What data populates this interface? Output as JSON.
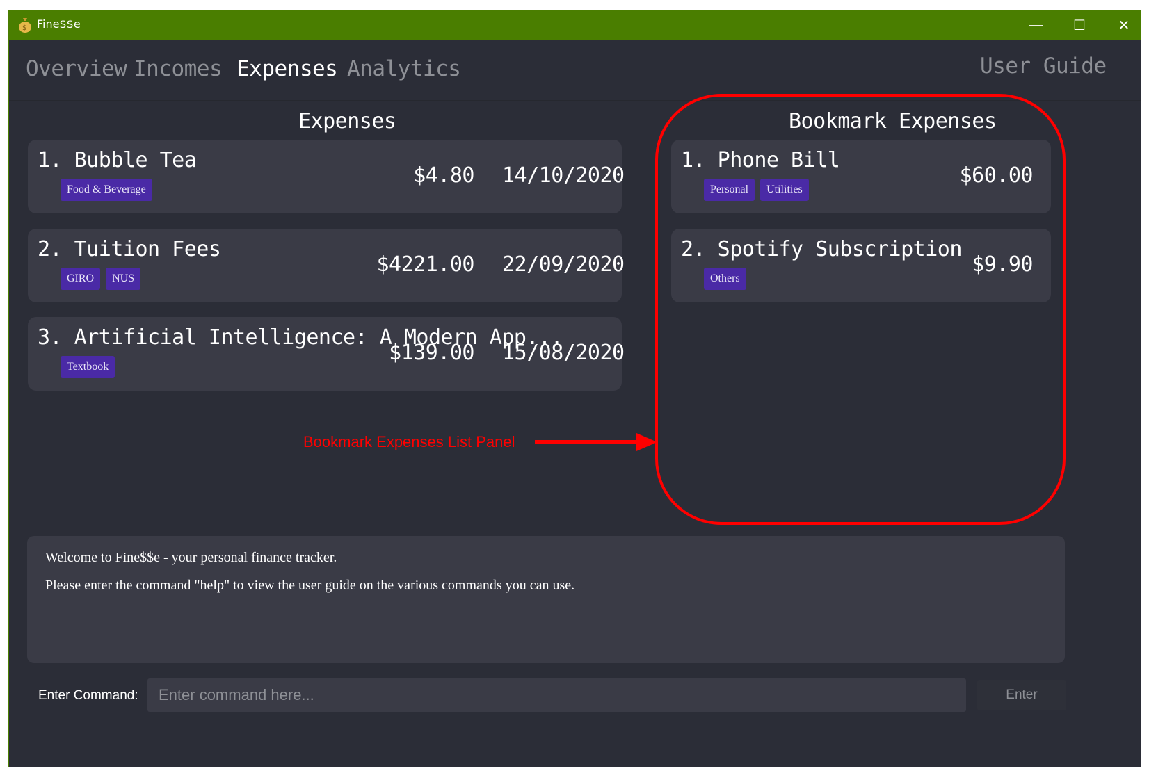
{
  "window": {
    "title": "Fine$$e",
    "minimize": "—",
    "maximize": "☐",
    "close": "✕"
  },
  "tabs": {
    "overview": "Overview",
    "incomes": "Incomes",
    "expenses": "Expenses",
    "analytics": "Analytics",
    "user_guide": "User Guide",
    "active": "Expenses"
  },
  "expenses_panel": {
    "title": "Expenses",
    "items": [
      {
        "title": "1. Bubble Tea",
        "amount": "$4.80",
        "date": "14/10/2020",
        "tags": [
          "Food & Beverage"
        ]
      },
      {
        "title": "2. Tuition Fees",
        "amount": "$4221.00",
        "date": "22/09/2020",
        "tags": [
          "GIRO",
          "NUS"
        ]
      },
      {
        "title": "3. Artificial Intelligence: A Modern App...",
        "amount": "$139.00",
        "date": "15/08/2020",
        "tags": [
          "Textbook"
        ]
      }
    ]
  },
  "bookmark_panel": {
    "title": "Bookmark Expenses",
    "items": [
      {
        "title": "1. Phone Bill",
        "amount": "$60.00",
        "tags": [
          "Personal",
          "Utilities"
        ]
      },
      {
        "title": "2. Spotify Subscription",
        "amount": "$9.90",
        "tags": [
          "Others"
        ]
      }
    ]
  },
  "annotation": {
    "label": "Bookmark Expenses List Panel",
    "color": "#ff0000"
  },
  "result_display": {
    "line1": "Welcome to Fine$$e - your personal finance tracker.",
    "line2": "Please enter the command \"help\" to view the user guide on the various commands you can use."
  },
  "command": {
    "label": "Enter Command:",
    "placeholder": "Enter command here...",
    "value": "",
    "button": "Enter"
  },
  "colors": {
    "titlebar": "#4a7e00",
    "background": "#2b2d37",
    "card": "#3a3b46",
    "tag": "#4a2aa6"
  }
}
